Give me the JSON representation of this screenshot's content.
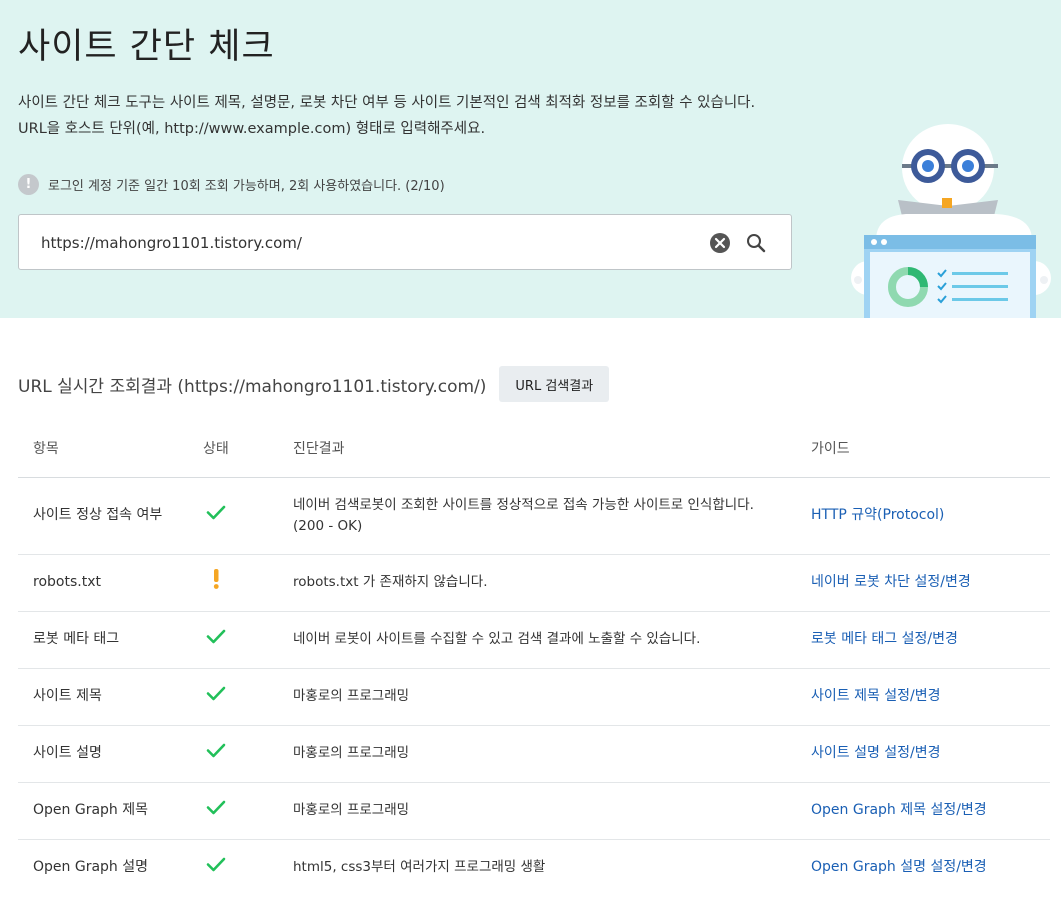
{
  "header": {
    "title": "사이트 간단 체크",
    "desc_line1": "사이트 간단 체크 도구는 사이트 제목, 설명문, 로봇 차단 여부 등 사이트 기본적인 검색 최적화 정보를 조회할 수 있습니다.",
    "desc_line2": "URL을 호스트 단위(예, http://www.example.com) 형태로 입력해주세요.",
    "notice_icon": "!",
    "notice": "로그인 계정 기준 일간 10회 조회 가능하며, 2회 사용하였습니다. (2/10)"
  },
  "search": {
    "value": "https://mahongro1101.tistory.com/",
    "clear_icon": "close-circle-icon",
    "search_icon": "magnifier-icon"
  },
  "results": {
    "title": "URL 실시간 조회결과 (https://mahongro1101.tistory.com/)",
    "button_label": "URL 검색결과",
    "columns": [
      "항목",
      "상태",
      "진단결과",
      "가이드"
    ],
    "colors": {
      "ok": "#22c05a",
      "warn": "#f5a623",
      "link": "#1a5fb4",
      "hero_bg": "#def4f1"
    },
    "rows": [
      {
        "item": "사이트 정상 접속 여부",
        "status": "ok",
        "result": "네이버 검색로봇이 조회한 사이트를 정상적으로 접속 가능한 사이트로 인식합니다.",
        "result2": "(200 - OK)",
        "guide": "HTTP 규약(Protocol)"
      },
      {
        "item": "robots.txt",
        "status": "warn",
        "result": "robots.txt 가 존재하지 않습니다.",
        "result2": "",
        "guide": "네이버 로봇 차단 설정/변경"
      },
      {
        "item": "로봇 메타 태그",
        "status": "ok",
        "result": "네이버 로봇이 사이트를 수집할 수 있고 검색 결과에 노출할 수 있습니다.",
        "result2": "",
        "guide": "로봇 메타 태그 설정/변경"
      },
      {
        "item": "사이트 제목",
        "status": "ok",
        "result": "마홍로의 프로그래밍",
        "result2": "",
        "guide": "사이트 제목 설정/변경"
      },
      {
        "item": "사이트 설명",
        "status": "ok",
        "result": "마홍로의 프로그래밍",
        "result2": "",
        "guide": "사이트 설명 설정/변경"
      },
      {
        "item": "Open Graph 제목",
        "status": "ok",
        "result": "마홍로의 프로그래밍",
        "result2": "",
        "guide": "Open Graph 제목 설정/변경"
      },
      {
        "item": "Open Graph 설명",
        "status": "ok",
        "result": "html5, css3부터 여러가지 프로그래밍 생활",
        "result2": "",
        "guide": "Open Graph 설명 설정/변경"
      }
    ]
  }
}
